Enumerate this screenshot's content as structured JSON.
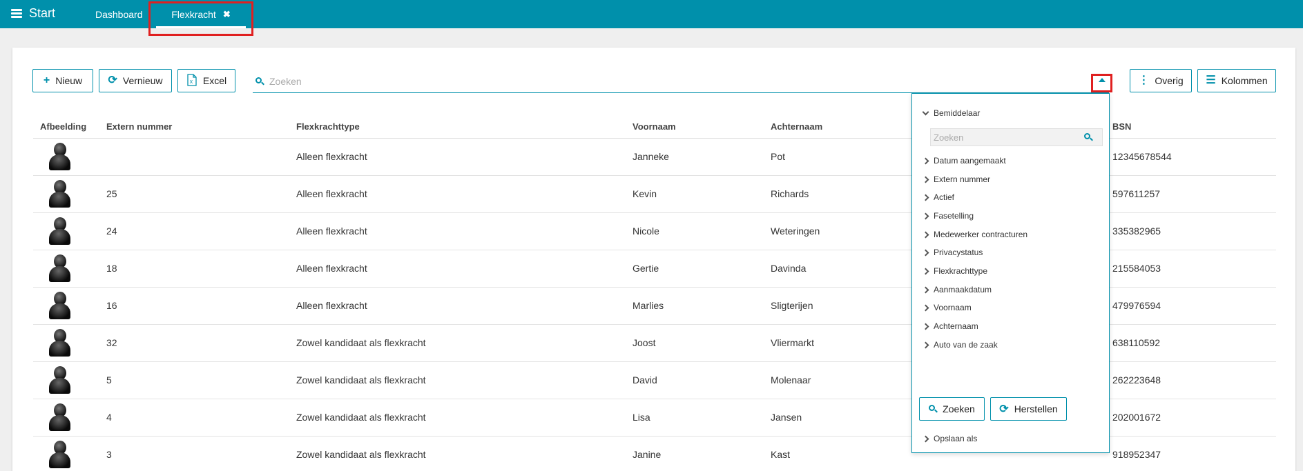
{
  "topbar": {
    "start_label": "Start",
    "tabs": [
      {
        "label": "Dashboard"
      },
      {
        "label": "Flexkracht",
        "close": "✖"
      }
    ]
  },
  "toolbar": {
    "new_label": "Nieuw",
    "refresh_label": "Vernieuw",
    "excel_label": "Excel",
    "search_placeholder": "Zoeken",
    "other_label": "Overig",
    "columns_label": "Kolommen"
  },
  "table": {
    "headers": [
      "Afbeelding",
      "Extern nummer",
      "Flexkrachttype",
      "Voornaam",
      "Achternaam",
      "BSN"
    ],
    "rows": [
      {
        "extern": "",
        "type": "Alleen flexkracht",
        "first": "Janneke",
        "last": "Pot",
        "bsn": "12345678544"
      },
      {
        "extern": "25",
        "type": "Alleen flexkracht",
        "first": "Kevin",
        "last": "Richards",
        "bsn": "597611257"
      },
      {
        "extern": "24",
        "type": "Alleen flexkracht",
        "first": "Nicole",
        "last": "Weteringen",
        "bsn": "335382965"
      },
      {
        "extern": "18",
        "type": "Alleen flexkracht",
        "first": "Gertie",
        "last": "Davinda",
        "bsn": "215584053"
      },
      {
        "extern": "16",
        "type": "Alleen flexkracht",
        "first": "Marlies",
        "last": "Sligterijen",
        "bsn": "479976594"
      },
      {
        "extern": "32",
        "type": "Zowel kandidaat als flexkracht",
        "first": "Joost",
        "last": "Vliermarkt",
        "bsn": "638110592"
      },
      {
        "extern": "5",
        "type": "Zowel kandidaat als flexkracht",
        "first": "David",
        "last": "Molenaar",
        "bsn": "262223648"
      },
      {
        "extern": "4",
        "type": "Zowel kandidaat als flexkracht",
        "first": "Lisa",
        "last": "Jansen",
        "bsn": "202001672"
      },
      {
        "extern": "3",
        "type": "Zowel kandidaat als flexkracht",
        "first": "Janine",
        "last": "Kast",
        "bsn": "918952347"
      }
    ]
  },
  "filter_panel": {
    "expanded_filter": "Bemiddelaar",
    "search_placeholder": "Zoeken",
    "filters": [
      "Datum aangemaakt",
      "Extern nummer",
      "Actief",
      "Fasetelling",
      "Medewerker contracturen",
      "Privacystatus",
      "Flexkrachttype",
      "Aanmaakdatum",
      "Voornaam",
      "Achternaam",
      "Auto van de zaak"
    ],
    "search_button": "Zoeken",
    "reset_button": "Herstellen",
    "save_as": "Opslaan als"
  },
  "colors": {
    "accent": "#0090ab",
    "highlight": "#e02020"
  },
  "icons": {
    "menu": "hamburger-icon",
    "close": "close-icon",
    "add": "plus-icon",
    "refresh": "refresh-icon",
    "excel": "excel-icon",
    "search": "search-icon",
    "collapse": "caret-up-icon",
    "more": "vertical-dots-icon",
    "columns": "list-icon",
    "expand": "chevron-right-icon",
    "expanded": "chevron-down-icon",
    "avatar": "person-silhouette-icon"
  }
}
